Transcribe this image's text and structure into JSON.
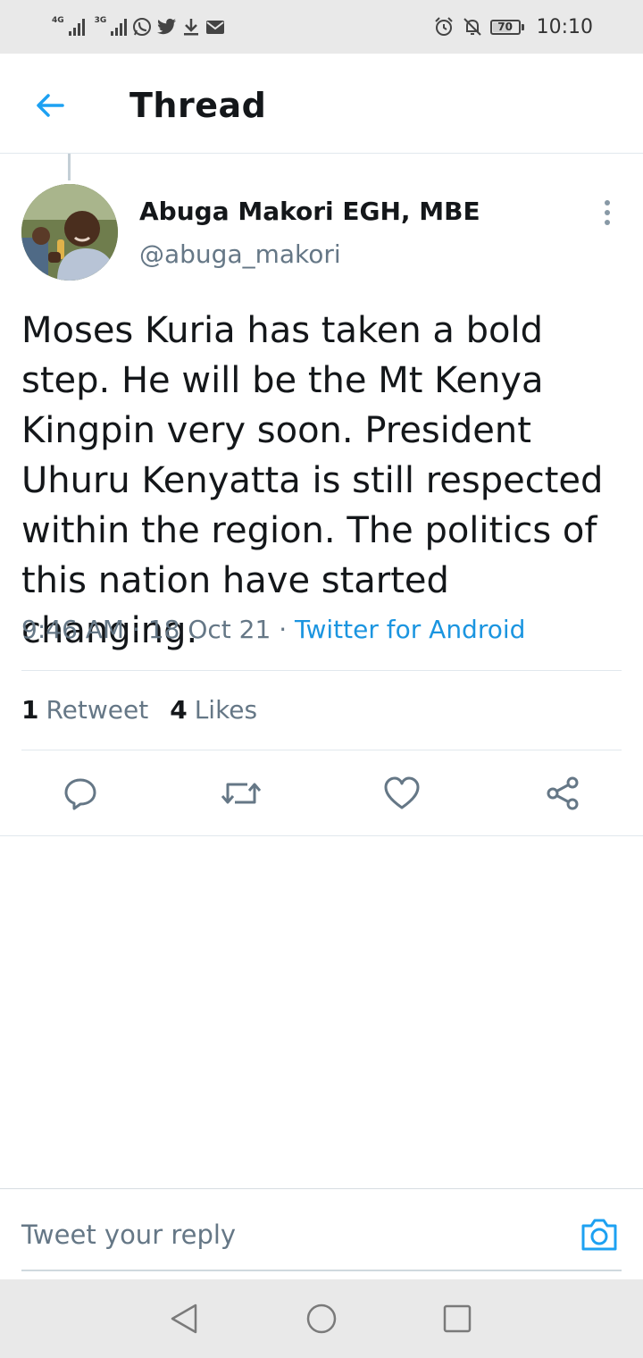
{
  "status_bar": {
    "network_1": "4G",
    "network_2": "3G",
    "battery": "70",
    "time": "10:10"
  },
  "header": {
    "title": "Thread"
  },
  "tweet": {
    "author_name": "Abuga Makori EGH, MBE",
    "author_handle": "@abuga_makori",
    "text": "Moses Kuria has taken a bold\nstep. He will be the Mt Kenya\nKingpin very soon. President\nUhuru Kenyatta is still respected\nwithin the region. The politics of\nthis nation have started changing.",
    "time": "9:46 AM",
    "date": "18 Oct 21",
    "separator": "·",
    "source": "Twitter for Android",
    "retweet_count": "1",
    "retweet_label": "Retweet",
    "like_count": "4",
    "like_label": "Likes"
  },
  "reply": {
    "placeholder": "Tweet your reply"
  },
  "colors": {
    "accent": "#1da1f2",
    "link": "#1b95e0",
    "text_primary": "#14171a",
    "text_secondary": "#657786",
    "divider": "#e1e8ed"
  },
  "icons": {
    "back": "arrow-left-icon",
    "more": "more-vertical-icon",
    "reply": "reply-icon",
    "retweet": "retweet-icon",
    "like": "heart-icon",
    "share": "share-icon",
    "camera": "camera-icon"
  }
}
